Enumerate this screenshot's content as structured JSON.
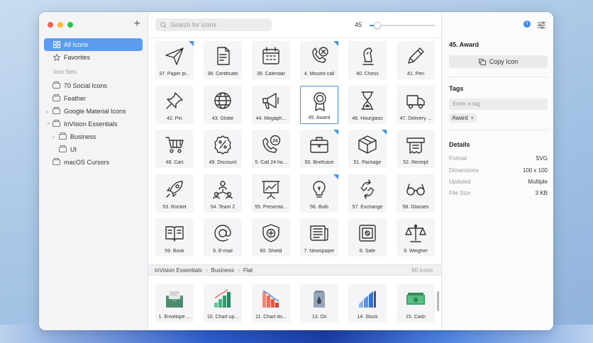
{
  "sidebar": {
    "add_label": "+",
    "items": [
      {
        "label": "All Icons",
        "icon": "grid-icon",
        "active": true
      },
      {
        "label": "Favorites",
        "icon": "star-icon"
      }
    ],
    "section_label": "Icon Sets",
    "sets": [
      {
        "label": "70 Social Icons",
        "indent": 0,
        "chevron": false
      },
      {
        "label": "Feather",
        "indent": 0,
        "chevron": false
      },
      {
        "label": "Google Material Icons",
        "indent": 0,
        "chevron": "›"
      },
      {
        "label": "InVision Essentials",
        "indent": 0,
        "chevron": "⌄"
      },
      {
        "label": "Business",
        "indent": 1,
        "chevron": "›"
      },
      {
        "label": "UI",
        "indent": 1,
        "chevron": false
      },
      {
        "label": "macOS Cursors",
        "indent": 0,
        "chevron": false
      }
    ]
  },
  "toolbar": {
    "search_placeholder": "Search for icons",
    "size_value": "45",
    "size_fraction": 0.12
  },
  "icons": [
    {
      "label": "37. Paper pl...",
      "glyph": "paper-plane-icon",
      "badge": true
    },
    {
      "label": "38. Certificate",
      "glyph": "certificate-icon",
      "badge": false
    },
    {
      "label": "39. Calendar",
      "glyph": "calendar-icon",
      "badge": false
    },
    {
      "label": "4. Missed call",
      "glyph": "missed-call-icon",
      "badge": true
    },
    {
      "label": "40. Chess",
      "glyph": "chess-icon",
      "badge": false
    },
    {
      "label": "41. Pen",
      "glyph": "pen-icon",
      "badge": false
    },
    {
      "label": "42. Pin",
      "glyph": "pin-icon",
      "badge": false
    },
    {
      "label": "43. Globe",
      "glyph": "globe-icon",
      "badge": false
    },
    {
      "label": "44. Megaph...",
      "glyph": "megaphone-icon",
      "badge": false
    },
    {
      "label": "45. Award",
      "glyph": "award-icon",
      "badge": false,
      "selected": true
    },
    {
      "label": "46. Hourglass",
      "glyph": "hourglass-icon",
      "badge": false
    },
    {
      "label": "47. Delivery ...",
      "glyph": "delivery-truck-icon",
      "badge": false
    },
    {
      "label": "48. Cart",
      "glyph": "cart-icon",
      "badge": false
    },
    {
      "label": "49. Discount",
      "glyph": "discount-icon",
      "badge": false
    },
    {
      "label": "5. Call 24 ho...",
      "glyph": "call-24-icon",
      "badge": false
    },
    {
      "label": "50. Briefcase",
      "glyph": "briefcase-icon",
      "badge": true
    },
    {
      "label": "51. Package",
      "glyph": "package-icon",
      "badge": true
    },
    {
      "label": "52. Receipt",
      "glyph": "receipt-icon",
      "badge": false
    },
    {
      "label": "53. Rocket",
      "glyph": "rocket-icon",
      "badge": false
    },
    {
      "label": "54. Team 2",
      "glyph": "team-icon",
      "badge": false
    },
    {
      "label": "55. Presenta...",
      "glyph": "presentation-icon",
      "badge": false
    },
    {
      "label": "56. Bulb",
      "glyph": "bulb-icon",
      "badge": true
    },
    {
      "label": "57. Exchange",
      "glyph": "exchange-icon",
      "badge": false
    },
    {
      "label": "58. Glasses",
      "glyph": "glasses-icon",
      "badge": false
    },
    {
      "label": "59. Book",
      "glyph": "book-icon",
      "badge": false
    },
    {
      "label": "6. E-mail",
      "glyph": "email-at-icon",
      "badge": false
    },
    {
      "label": "60. Shield",
      "glyph": "shield-icon",
      "badge": false
    },
    {
      "label": "7. Newspaper",
      "glyph": "newspaper-icon",
      "badge": false
    },
    {
      "label": "8. Safe",
      "glyph": "safe-icon",
      "badge": false
    },
    {
      "label": "9. Weigher",
      "glyph": "weigher-icon",
      "badge": false
    }
  ],
  "breadcrumb": {
    "items": [
      "InVision Essentials",
      "Business",
      "Flat"
    ],
    "count": "60 icons"
  },
  "flat_icons": [
    {
      "label": "1. Envelope ...",
      "glyph": "envelope-color-icon"
    },
    {
      "label": "10. Chart up...",
      "glyph": "chart-up-color-icon"
    },
    {
      "label": "11. Chart do...",
      "glyph": "chart-down-color-icon"
    },
    {
      "label": "13. Oil",
      "glyph": "oil-color-icon"
    },
    {
      "label": "14. Stock",
      "glyph": "stock-color-icon"
    },
    {
      "label": "15. Cash",
      "glyph": "cash-color-icon"
    }
  ],
  "panel": {
    "title": "45. Award",
    "copy_label": "Copy Icon",
    "tags_heading": "Tags",
    "tag_placeholder": "Enter a tag",
    "tags": [
      "Award"
    ],
    "details_heading": "Details",
    "details": [
      {
        "key": "Format",
        "value": "SVG"
      },
      {
        "key": "Dimensions",
        "value": "100 x 100"
      },
      {
        "key": "Updated",
        "value": "Multiple"
      },
      {
        "key": "File Size",
        "value": "3 KB"
      }
    ]
  },
  "colors": {
    "accent": "#4a90e2",
    "sidebar_active": "#5b9bf0"
  }
}
